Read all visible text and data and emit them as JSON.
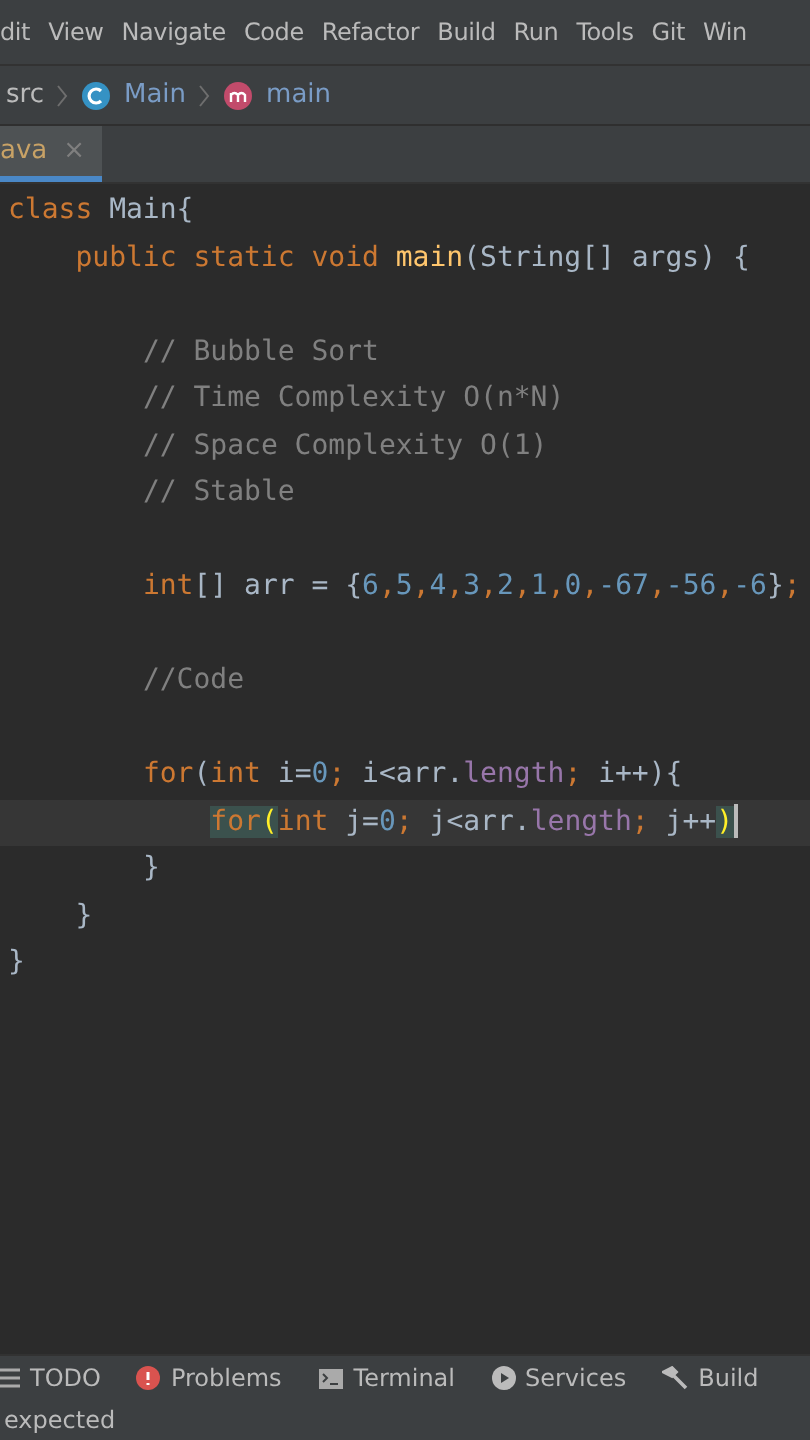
{
  "menu": [
    "dit",
    "View",
    "Navigate",
    "Code",
    "Refactor",
    "Build",
    "Run",
    "Tools",
    "Git",
    "Win"
  ],
  "breadcrumb": [
    {
      "kind": "folder",
      "label": "src"
    },
    {
      "kind": "class",
      "label": "Main"
    },
    {
      "kind": "method",
      "label": "main"
    }
  ],
  "tabs": [
    {
      "label": "ava",
      "selected": true,
      "close": "×"
    }
  ],
  "code": [
    {
      "blank_before": false,
      "highlighted": false,
      "tokens": [
        {
          "kind": "kw",
          "text": "class "
        },
        {
          "kind": "plain",
          "text": "Main{"
        }
      ]
    },
    {
      "blank_before": false,
      "highlighted": false,
      "tokens": [
        {
          "kind": "kw",
          "text": "    public static void "
        },
        {
          "kind": "method",
          "text": "main"
        },
        {
          "kind": "plain",
          "text": "(String[] args) {"
        }
      ]
    },
    {
      "blank_before": true,
      "highlighted": false,
      "tokens": [
        {
          "kind": "comment",
          "text": "        // Bubble Sort"
        }
      ]
    },
    {
      "blank_before": false,
      "highlighted": false,
      "tokens": [
        {
          "kind": "comment",
          "text": "        // Time Complexity O(n*N)"
        }
      ]
    },
    {
      "blank_before": false,
      "highlighted": false,
      "tokens": [
        {
          "kind": "comment",
          "text": "        // Space Complexity O(1)"
        }
      ]
    },
    {
      "blank_before": false,
      "highlighted": false,
      "tokens": [
        {
          "kind": "comment",
          "text": "        // Stable"
        }
      ]
    },
    {
      "blank_before": true,
      "highlighted": false,
      "tokens": [
        {
          "kind": "kw",
          "text": "        int"
        },
        {
          "kind": "plain",
          "text": "[] arr = {"
        },
        {
          "kind": "num",
          "text": "6"
        },
        {
          "kind": "kw",
          "text": ","
        },
        {
          "kind": "num",
          "text": "5"
        },
        {
          "kind": "kw",
          "text": ","
        },
        {
          "kind": "num",
          "text": "4"
        },
        {
          "kind": "kw",
          "text": ","
        },
        {
          "kind": "num",
          "text": "3"
        },
        {
          "kind": "kw",
          "text": ","
        },
        {
          "kind": "num",
          "text": "2"
        },
        {
          "kind": "kw",
          "text": ","
        },
        {
          "kind": "num",
          "text": "1"
        },
        {
          "kind": "kw",
          "text": ","
        },
        {
          "kind": "num",
          "text": "0"
        },
        {
          "kind": "kw",
          "text": ","
        },
        {
          "kind": "num",
          "text": "-67"
        },
        {
          "kind": "kw",
          "text": ","
        },
        {
          "kind": "num",
          "text": "-56"
        },
        {
          "kind": "kw",
          "text": ","
        },
        {
          "kind": "num",
          "text": "-6"
        },
        {
          "kind": "plain",
          "text": "}"
        },
        {
          "kind": "kw",
          "text": ";"
        }
      ]
    },
    {
      "blank_before": true,
      "highlighted": false,
      "tokens": [
        {
          "kind": "comment",
          "text": "        //Code"
        }
      ]
    },
    {
      "blank_before": true,
      "highlighted": false,
      "tokens": [
        {
          "kind": "kw",
          "text": "        for"
        },
        {
          "kind": "plain",
          "text": "("
        },
        {
          "kind": "kw",
          "text": "int "
        },
        {
          "kind": "plain",
          "text": "i="
        },
        {
          "kind": "num",
          "text": "0"
        },
        {
          "kind": "kw",
          "text": "; "
        },
        {
          "kind": "plain",
          "text": "i<arr."
        },
        {
          "kind": "field",
          "text": "length"
        },
        {
          "kind": "kw",
          "text": "; "
        },
        {
          "kind": "plain",
          "text": "i++){"
        }
      ]
    },
    {
      "blank_before": false,
      "highlighted": true,
      "tokens": [
        {
          "kind": "match",
          "text": "            for"
        },
        {
          "kind": "bracket",
          "text": "("
        },
        {
          "kind": "kw",
          "text": "int "
        },
        {
          "kind": "plain",
          "text": "j="
        },
        {
          "kind": "num",
          "text": "0"
        },
        {
          "kind": "kw",
          "text": "; "
        },
        {
          "kind": "plain",
          "text": "j<arr."
        },
        {
          "kind": "field",
          "text": "length"
        },
        {
          "kind": "kw",
          "text": "; "
        },
        {
          "kind": "plain",
          "text": "j++"
        },
        {
          "kind": "bracket",
          "text": ")"
        }
      ]
    },
    {
      "blank_before": false,
      "highlighted": false,
      "tokens": [
        {
          "kind": "plain",
          "text": "        }"
        }
      ]
    },
    {
      "blank_before": false,
      "highlighted": false,
      "tokens": [
        {
          "kind": "plain",
          "text": "    }"
        }
      ]
    },
    {
      "blank_before": false,
      "highlighted": false,
      "tokens": [
        {
          "kind": "plain",
          "text": "}"
        }
      ]
    }
  ],
  "tool_tabs": [
    {
      "kind": "list",
      "label": "TODO"
    },
    {
      "kind": "error",
      "label": "Problems"
    },
    {
      "kind": "terminal",
      "label": "Terminal"
    },
    {
      "kind": "play",
      "label": "Services"
    },
    {
      "kind": "hammer",
      "label": "Build"
    }
  ],
  "status": "expected"
}
